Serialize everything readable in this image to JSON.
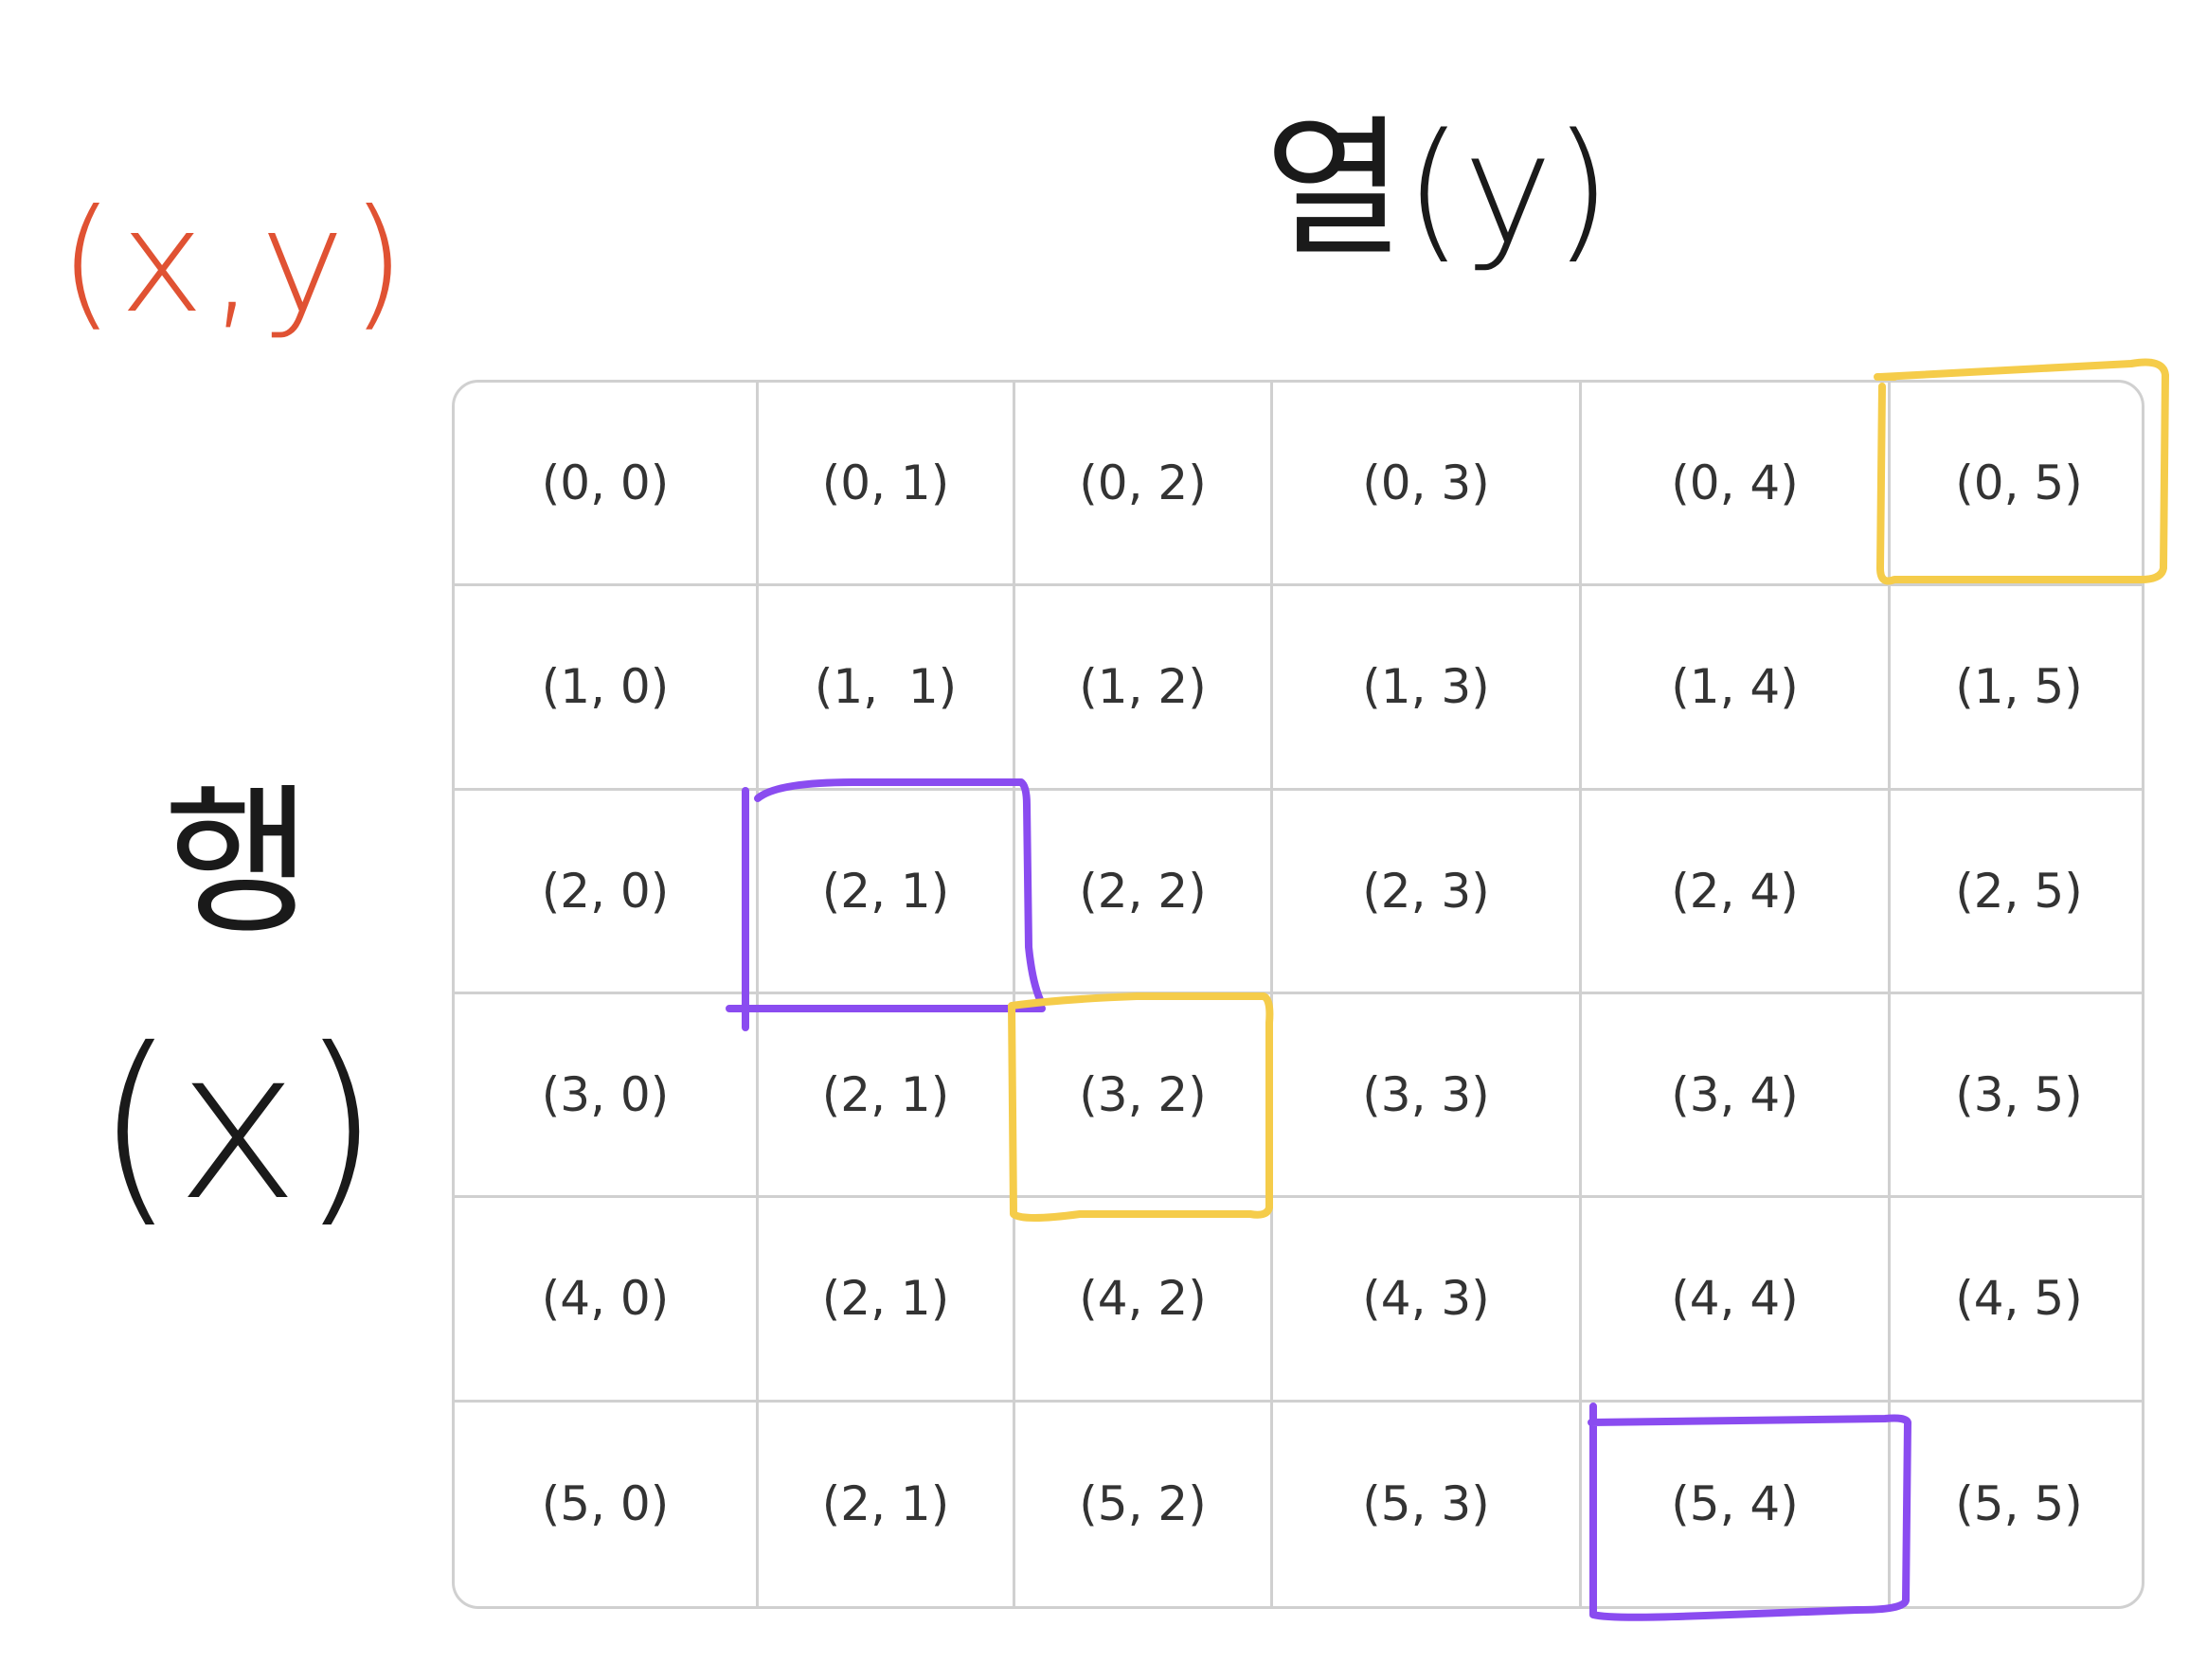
{
  "annotations": {
    "title": "(x,y)",
    "column_label": "열(y)",
    "row_label_char": "행",
    "row_label_var": "(x)"
  },
  "colors": {
    "title": "#e05233",
    "ink": "#1a1a1a",
    "purple": "#8a4cf0",
    "yellow": "#f5cc4a",
    "grid_line": "#d0d0d0",
    "cell_text": "#333333"
  },
  "grid": {
    "rows": [
      [
        "(0, 0)",
        "(0, 1)",
        "(0, 2)",
        "(0, 3)",
        "(0, 4)",
        "(0, 5)"
      ],
      [
        "(1, 0)",
        "(1,  1)",
        "(1, 2)",
        "(1, 3)",
        "(1, 4)",
        "(1, 5)"
      ],
      [
        "(2, 0)",
        "(2, 1)",
        "(2, 2)",
        "(2, 3)",
        "(2, 4)",
        "(2, 5)"
      ],
      [
        "(3, 0)",
        "(2, 1)",
        "(3, 2)",
        "(3, 3)",
        "(3, 4)",
        "(3, 5)"
      ],
      [
        "(4, 0)",
        "(2, 1)",
        "(4, 2)",
        "(4, 3)",
        "(4, 4)",
        "(4, 5)"
      ],
      [
        "(5, 0)",
        "(2, 1)",
        "(5, 2)",
        "(5, 3)",
        "(5, 4)",
        "(5, 5)"
      ]
    ]
  },
  "highlights": [
    {
      "cell": "(0, 5)",
      "color": "yellow"
    },
    {
      "cell": "(2, 1)",
      "color": "purple"
    },
    {
      "cell": "(3, 2)",
      "color": "yellow"
    },
    {
      "cell": "(5, 4)",
      "color": "purple"
    }
  ]
}
